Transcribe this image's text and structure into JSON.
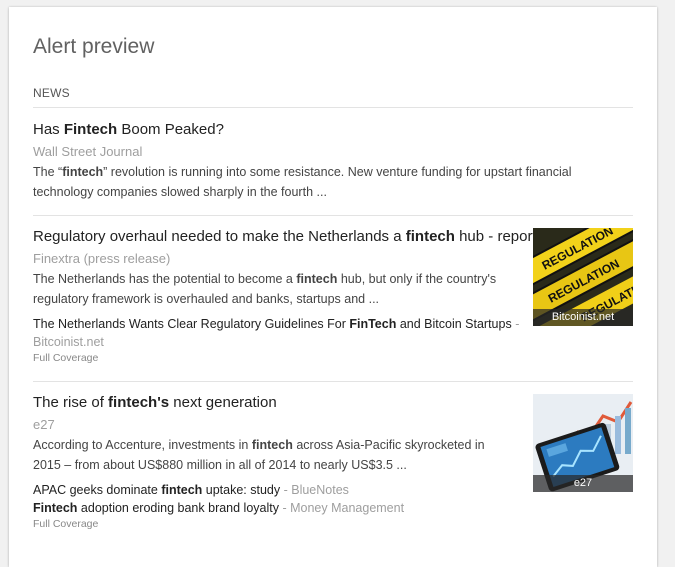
{
  "panel": {
    "title": "Alert preview",
    "section_label": "NEWS"
  },
  "articles": [
    {
      "headline": {
        "pre": "Has ",
        "bold": "Fintech",
        "post": " Boom Peaked?"
      },
      "source": "Wall Street Journal",
      "snippet": {
        "pre": "The “",
        "bold": "fintech",
        "post": "” revolution is running into some resistance. New venture funding for upstart financial technology companies slowed sharply in the fourth ..."
      }
    },
    {
      "headline": {
        "pre": "Regulatory overhaul needed to make the Netherlands a ",
        "bold": "fintech",
        "post": " hub - report."
      },
      "source": "Finextra (press release)",
      "snippet": {
        "pre": "The Netherlands has the potential to become a ",
        "bold": "fintech",
        "post": " hub, but only if the country's regulatory framework is overhauled and banks, startups and ..."
      },
      "related": [
        {
          "pre": "The Netherlands Wants Clear Regulatory Guidelines For ",
          "bold": "FinTech",
          "post": " and Bitcoin Startups",
          "source": " - ",
          "source_line2": "Bitcoinist.net"
        }
      ],
      "full_coverage": "Full Coverage",
      "thumb_caption": "Bitcoinist.net",
      "thumb_sign_text": "REGULATION"
    },
    {
      "headline": {
        "pre": "The rise of ",
        "bold": "fintech's",
        "post": " next generation"
      },
      "source": "e27",
      "snippet": {
        "pre": "According to Accenture, investments in ",
        "bold": "fintech",
        "post": " across Asia-Pacific skyrocketed in 2015 – from about US$880 million in all of 2014 to nearly US$3.5 ..."
      },
      "related": [
        {
          "pre": "APAC geeks dominate ",
          "bold": "fintech",
          "post": " uptake: study",
          "source": " - BlueNotes"
        },
        {
          "pre": "",
          "bold": "Fintech",
          "post": " adoption eroding bank brand loyalty",
          "source": " - Money Management"
        }
      ],
      "full_coverage": "Full Coverage",
      "thumb_caption": "e27"
    }
  ]
}
